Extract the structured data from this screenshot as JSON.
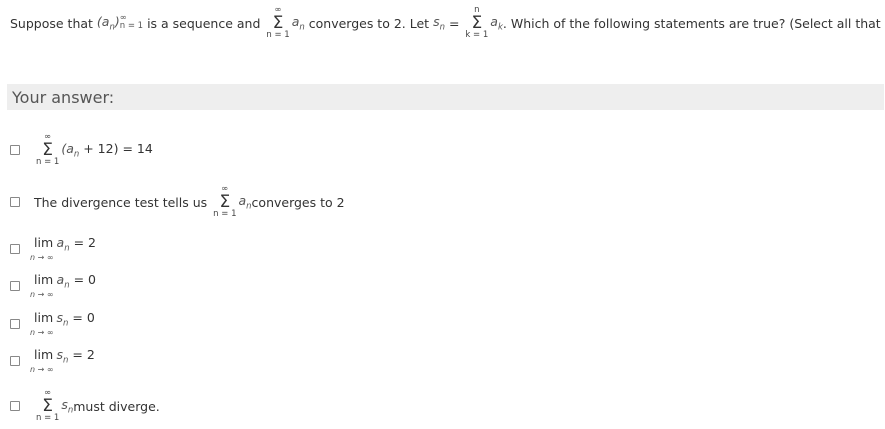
{
  "question": {
    "prefix": "Suppose that",
    "seq": "(a",
    "seq_sub": "n",
    "seq_close": ")",
    "seq_sup": "∞",
    "seq_bottom": "n = 1",
    "mid1": "is a sequence and",
    "sum1_top": "∞",
    "sum1_bot": "n = 1",
    "sum1_term": "a",
    "sum1_sub": "n",
    "mid2": "converges to 2. Let",
    "s": "s",
    "s_sub": "n",
    "eq": "=",
    "sum2_top": "n",
    "sum2_bot": "k = 1",
    "sum2_term": "a",
    "sum2_sub": "k",
    "suffix": ". Which of the following statements are true? (Select all that apply)"
  },
  "answer_label": "Your answer:",
  "options": [
    {
      "top": "∞",
      "bot": "n = 1",
      "body": "(a",
      "sub": "n",
      "rest": " + 12) = 14"
    },
    {
      "pre": "The divergence test tells us",
      "top": "∞",
      "bot": "n = 1",
      "term": "a",
      "sub": "n",
      "rest": " converges to 2"
    },
    {
      "lim": "lim",
      "under": "n → ∞",
      "var": "a",
      "sub": "n",
      "rest": " = 2"
    },
    {
      "lim": "lim",
      "under": "n → ∞",
      "var": "a",
      "sub": "n",
      "rest": " = 0"
    },
    {
      "lim": "lim",
      "under": "n → ∞",
      "var": "s",
      "sub": "n",
      "rest": " = 0"
    },
    {
      "lim": "lim",
      "under": "n → ∞",
      "var": "s",
      "sub": "n",
      "rest": " = 2"
    },
    {
      "top": "∞",
      "bot": "n = 1",
      "term": "s",
      "sub": "n",
      "rest": " must diverge."
    }
  ],
  "sigma": "Σ"
}
